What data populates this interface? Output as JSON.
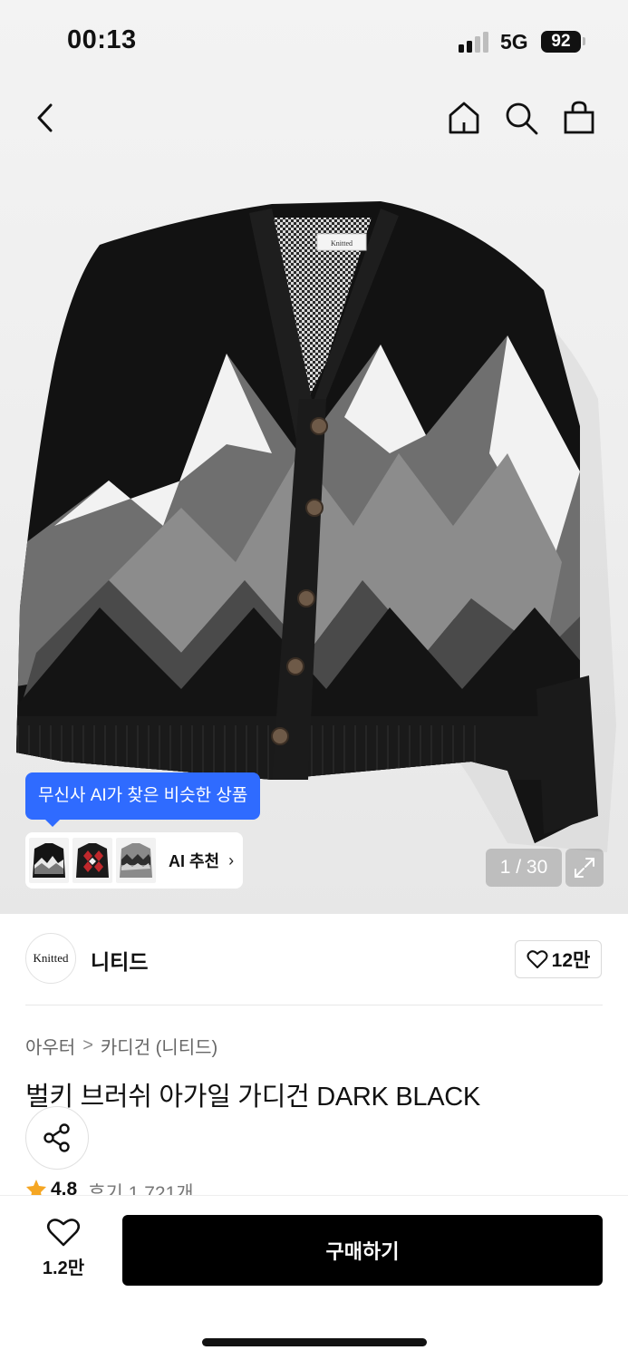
{
  "status_bar": {
    "time": "00:13",
    "network": "5G",
    "battery": "92"
  },
  "nav": {
    "back_icon": "chevron-left-icon",
    "home_icon": "home-icon",
    "search_icon": "search-icon",
    "cart_icon": "shopping-bag-icon"
  },
  "gallery": {
    "tag_text": "Knitted",
    "counter": "1 / 30",
    "ai_banner": "무신사 AI가 찾은 비슷한 상품",
    "ai_recommend_label": "AI 추천",
    "ai_recommend_chevron": "›",
    "colors": {
      "accent": "#2f6bff"
    }
  },
  "brand": {
    "logo_text": "Knitted",
    "name": "니티드",
    "like_count": "12만"
  },
  "breadcrumb": {
    "level1": "아우터",
    "separator": ">",
    "level2": "카디건 (니티드)"
  },
  "product": {
    "title": "벌키 브러쉬 아가일 가디건 DARK BLACK",
    "rating": "4.8",
    "reviews": "후기 1,721개"
  },
  "footer": {
    "like_count": "1.2만",
    "buy_label": "구매하기"
  }
}
